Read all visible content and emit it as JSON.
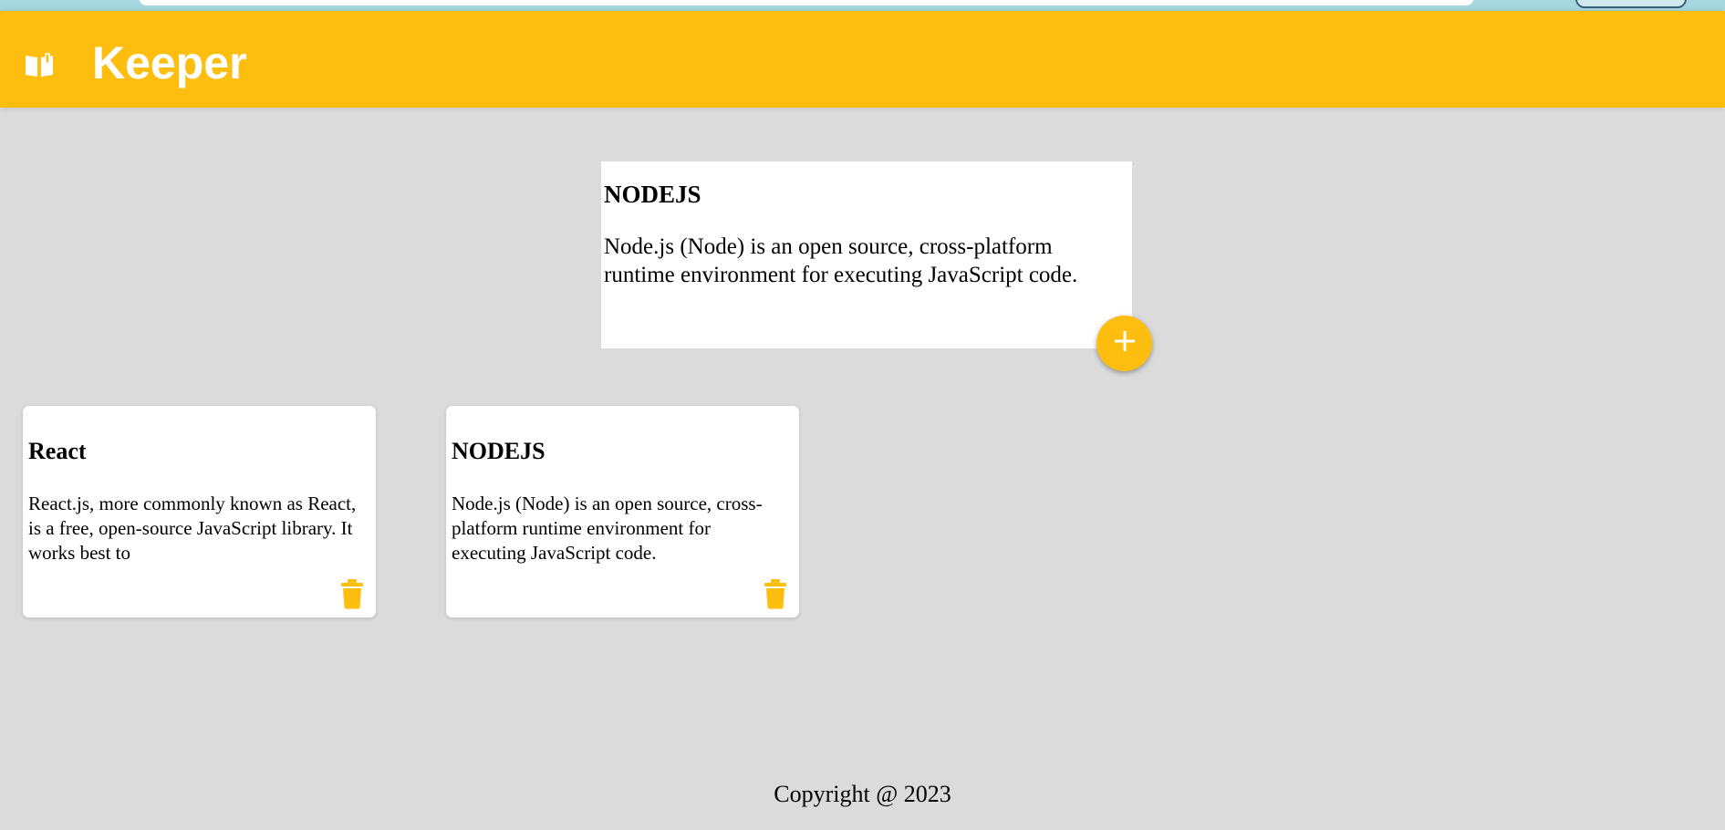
{
  "header": {
    "title": "Keeper",
    "logo_icon": "open-book-icon"
  },
  "create_area": {
    "title": "NODEJS",
    "content": "Node.js (Node) is an open source, cross-platform runtime environment for executing JavaScript code.",
    "add_icon": "plus-icon"
  },
  "notes": [
    {
      "title": "React",
      "content": "React.js, more commonly known as React, is a free, open-source JavaScript library. It works best to",
      "delete_icon": "trash-icon"
    },
    {
      "title": "NODEJS",
      "content": "Node.js (Node) is an open source, cross-platform runtime environment for executing JavaScript code.",
      "delete_icon": "trash-icon"
    }
  ],
  "footer": {
    "copyright": "Copyright @ 2023"
  },
  "colors": {
    "accent": "#fdbe10",
    "background": "#dbdbdb",
    "card": "#ffffff"
  }
}
